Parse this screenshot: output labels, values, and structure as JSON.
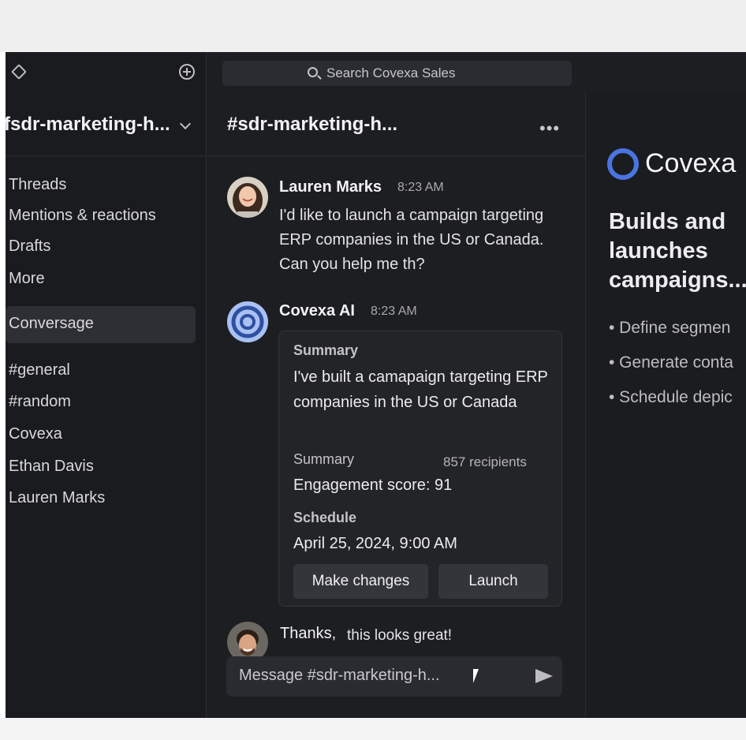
{
  "search": {
    "placeholder": "Search Covexa Sales"
  },
  "workspace": {
    "name": "fsdr-marketing-h..."
  },
  "sidebar": {
    "nav": [
      {
        "label": "Threads"
      },
      {
        "label": "Mentions & reactions"
      },
      {
        "label": "Drafts"
      },
      {
        "label": "More"
      }
    ],
    "active": {
      "label": "Conversage"
    },
    "channels": [
      {
        "label": "#general"
      },
      {
        "label": "#random"
      },
      {
        "label": "Covexa"
      },
      {
        "label": "Ethan Davis"
      },
      {
        "label": "Lauren Marks"
      }
    ]
  },
  "channel": {
    "title": "#sdr-marketing-h...",
    "more_icon": "more-horizontal-icon"
  },
  "messages": [
    {
      "author": "Lauren Marks",
      "time": "8:23 AM",
      "text": "I'd like to launch a campaign targeting ERP companies in the US or Canada. Can you help me th?"
    },
    {
      "author": "Covexa AI",
      "time": "8:23 AM"
    },
    {
      "author": "Thanks,",
      "text": "this looks great!"
    }
  ],
  "card": {
    "summary_label": "Summary",
    "summary_text": "I've built a camapaign targeting ERP companies in the US or Canada",
    "summary2_label": "Summary",
    "recipients": "857 recipients",
    "engagement": "Engagement score: 91",
    "schedule_label": "Schedule",
    "schedule_value": "April 25, 2024, 9:00 AM",
    "make_changes": "Make changes",
    "launch": "Launch"
  },
  "composer": {
    "placeholder": "Message #sdr-marketing-h..."
  },
  "right_panel": {
    "brand": "Covexa",
    "heading": [
      "Builds and",
      "launches",
      "campaigns..."
    ],
    "bullets": [
      "• Define segmen",
      "• Generate conta",
      "• Schedule depic"
    ]
  },
  "colors": {
    "accent": "#4a74e0",
    "background": "#1d1e21",
    "sidebar": "#1a1b1e"
  }
}
